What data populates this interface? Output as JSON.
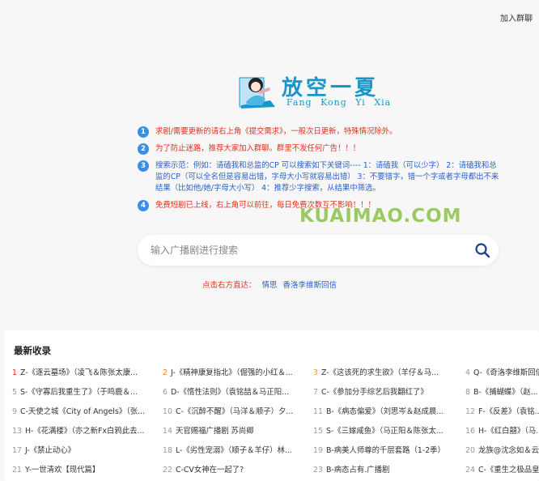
{
  "header": {
    "join_group": "加入群聊"
  },
  "logo": {
    "title": "放空一夏",
    "subtitle": "Fang Kong Yi Xia"
  },
  "notices": [
    {
      "num": "1",
      "tone": "red",
      "text": "求剧/需要更新的请右上角《提交需求》，一般次日更新，特殊情况除外。"
    },
    {
      "num": "2",
      "tone": "red",
      "text": "为了防止迷路，推荐大家加入群聊。群里不发任何广告！！！"
    },
    {
      "num": "3",
      "tone": "blue",
      "text": "搜索示范：例如：请磕我和总监的CP 可以搜索如下关键词---- 1：请磕我（可以少字） 2：请磕我和总监的CP（可以全名但是容易出错，字母大小写就容易出错） 3：不要错字，错一个字或者字母都出不来结果（比如他/她/字母大小写） 4：推荐少字搜索，从结果中筛选。"
    },
    {
      "num": "4",
      "tone": "red",
      "text": "免费短剧已上线，右上角可以前往，每日免费次数互不影响！！！"
    }
  ],
  "watermark": "KUAIMAO.COM",
  "search": {
    "placeholder": "输入广播剧进行搜索"
  },
  "quick_links": {
    "label": "点击右方直达：",
    "links": [
      "情思",
      "香洛李维斯回信"
    ]
  },
  "latest": {
    "title": "最新收录",
    "items": [
      {
        "num": "1",
        "text": "Z-《逐云墓场》（凌飞＆陈张太康..."
      },
      {
        "num": "2",
        "text": "J-《精神康复指北》（倔强的小红＆..."
      },
      {
        "num": "3",
        "text": "Z-《这该死的求生欲》（羊仔＆马..."
      },
      {
        "num": "4",
        "text": "Q-《奇洛李维斯回信》"
      },
      {
        "num": "5",
        "text": "S-《守寡后我重生了》（于鸣鹿＆..."
      },
      {
        "num": "6",
        "text": "D-《惰性法则》（袁铭喆＆马正阳..."
      },
      {
        "num": "7",
        "text": "C-《参加分手综艺后我翻红了》"
      },
      {
        "num": "8",
        "text": "B-《捕蝴蝶》（赵..."
      },
      {
        "num": "9",
        "text": "C-天使之城《City of Angels》（张..."
      },
      {
        "num": "10",
        "text": "C-《沉醉不醒》（马洋＆顺子）夕..."
      },
      {
        "num": "11",
        "text": "B-《病态偏爱》（刘思岑＆赵成晨..."
      },
      {
        "num": "12",
        "text": "F-《反差》（袁铭..."
      },
      {
        "num": "13",
        "text": "H-《花满楼》（亦之新Fx白鸦此去..."
      },
      {
        "num": "14",
        "text": "天官赐福广播剧 苏尚卿"
      },
      {
        "num": "15",
        "text": "S-《三嫁咸鱼》（马正阳＆陈张太..."
      },
      {
        "num": "16",
        "text": "H-《红白囍》（马..."
      },
      {
        "num": "17",
        "text": "J-《禁止动心》"
      },
      {
        "num": "18",
        "text": "L-《劣性宠溺》（顺子＆羊仔）林..."
      },
      {
        "num": "19",
        "text": "B-病美人师尊的千层套路（1-2季）"
      },
      {
        "num": "20",
        "text": "龙族@沈念如＆云..."
      },
      {
        "num": "21",
        "text": "Y-一世清欢【现代篇】"
      },
      {
        "num": "22",
        "text": "C-CV女神在一起了?"
      },
      {
        "num": "23",
        "text": "B-病态占有.广播剧"
      },
      {
        "num": "24",
        "text": "C-《重生之极品皇..."
      }
    ]
  },
  "colors": {
    "accent": "#1b95c9",
    "red": "#e0301e",
    "blue": "#2961c8",
    "badge": "#3a8ee6"
  }
}
